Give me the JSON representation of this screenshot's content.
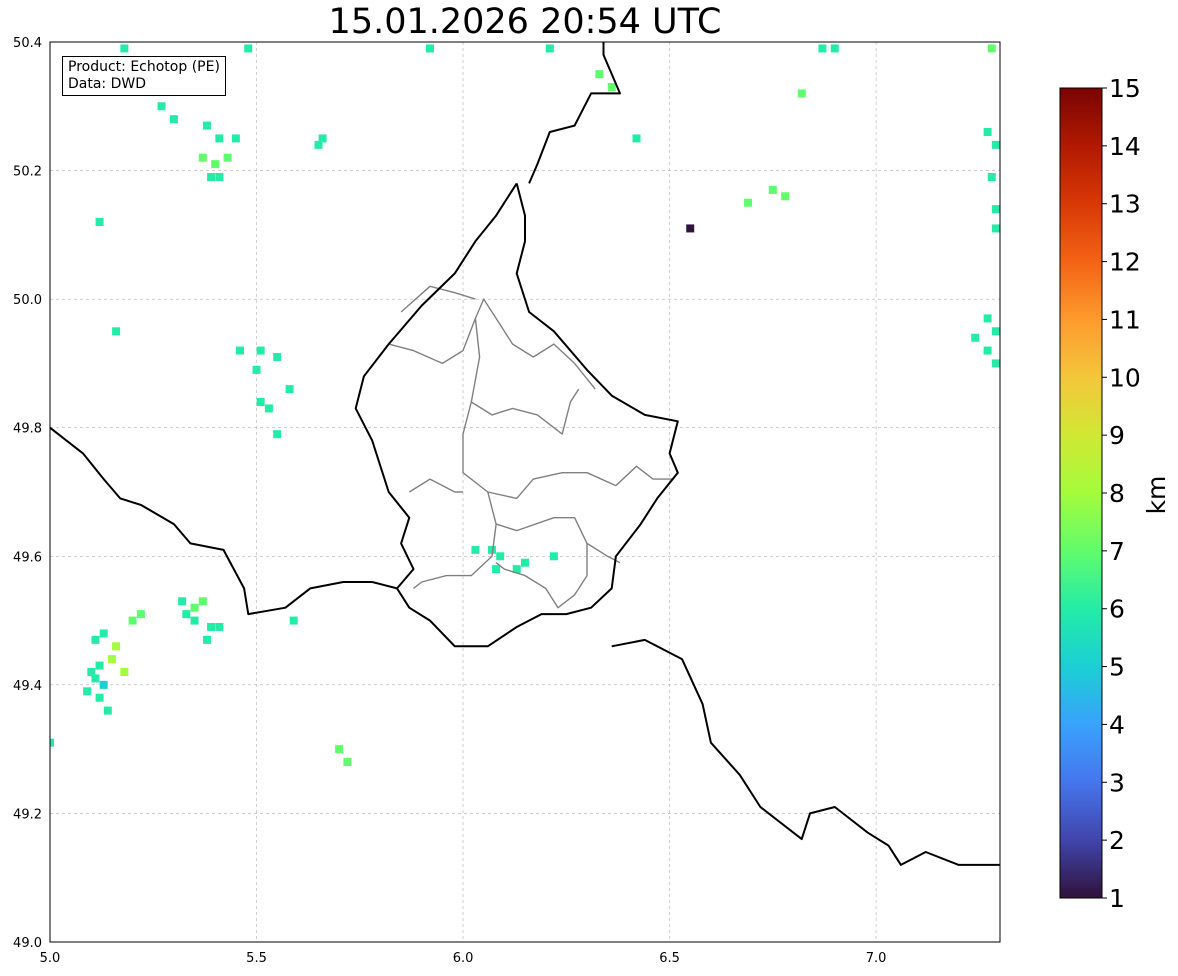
{
  "title": "15.01.2026 20:54 UTC",
  "info": {
    "product_line": "Product: Echotop (PE)",
    "data_line": "Data: DWD"
  },
  "colorbar": {
    "label": "km",
    "min": 1,
    "max": 15,
    "ticks": [
      "1",
      "2",
      "3",
      "4",
      "5",
      "6",
      "7",
      "8",
      "9",
      "10",
      "11",
      "12",
      "13",
      "14",
      "15"
    ],
    "colormap": [
      "#30123b",
      "#4145ab",
      "#4675ed",
      "#39a2fc",
      "#1bcfd4",
      "#24eca6",
      "#61fc6c",
      "#a4fc3b",
      "#d1e834",
      "#f3c63a",
      "#fe9b2d",
      "#f36315",
      "#d93806",
      "#b11901",
      "#7a0402"
    ]
  },
  "map": {
    "lon_range": [
      5.0,
      7.3
    ],
    "lat_range": [
      49.0,
      50.4
    ],
    "x_ticks": [
      "5.0",
      "5.5",
      "6.0",
      "6.5",
      "7.0"
    ],
    "y_ticks": [
      "49.0",
      "49.2",
      "49.4",
      "49.6",
      "49.8",
      "50.0",
      "50.2",
      "50.4"
    ],
    "grid": "dashed",
    "border_color": "#000000",
    "canton_color": "#808080",
    "national_borders": [
      [
        [
          6.13,
          50.18
        ],
        [
          6.08,
          50.13
        ],
        [
          6.03,
          50.09
        ],
        [
          5.98,
          50.04
        ],
        [
          5.9,
          49.99
        ],
        [
          5.82,
          49.93
        ],
        [
          5.76,
          49.88
        ],
        [
          5.74,
          49.83
        ],
        [
          5.78,
          49.78
        ],
        [
          5.82,
          49.7
        ],
        [
          5.87,
          49.66
        ],
        [
          5.85,
          49.62
        ],
        [
          5.88,
          49.58
        ],
        [
          5.84,
          49.55
        ],
        [
          5.78,
          49.56
        ]
      ],
      [
        [
          6.13,
          50.18
        ],
        [
          6.15,
          50.13
        ],
        [
          6.15,
          50.09
        ],
        [
          6.13,
          50.04
        ],
        [
          6.16,
          49.98
        ],
        [
          6.22,
          49.95
        ],
        [
          6.3,
          49.89
        ],
        [
          6.36,
          49.85
        ],
        [
          6.44,
          49.82
        ],
        [
          6.52,
          49.81
        ],
        [
          6.5,
          49.76
        ],
        [
          6.52,
          49.73
        ],
        [
          6.47,
          49.69
        ],
        [
          6.43,
          49.65
        ],
        [
          6.37,
          49.6
        ],
        [
          6.36,
          49.55
        ],
        [
          6.31,
          49.52
        ],
        [
          6.25,
          49.51
        ],
        [
          6.19,
          49.51
        ],
        [
          6.13,
          49.49
        ],
        [
          6.06,
          49.46
        ],
        [
          5.98,
          49.46
        ],
        [
          5.92,
          49.5
        ],
        [
          5.87,
          49.52
        ],
        [
          5.84,
          49.55
        ]
      ],
      [
        [
          6.16,
          50.18
        ],
        [
          6.18,
          50.21
        ],
        [
          6.21,
          50.26
        ],
        [
          6.27,
          50.27
        ],
        [
          6.31,
          50.32
        ],
        [
          6.38,
          50.32
        ],
        [
          6.34,
          50.38
        ],
        [
          6.34,
          50.4
        ]
      ],
      [
        [
          5.0,
          49.8
        ],
        [
          5.08,
          49.76
        ],
        [
          5.13,
          49.72
        ],
        [
          5.17,
          49.69
        ],
        [
          5.22,
          49.68
        ],
        [
          5.3,
          49.65
        ],
        [
          5.34,
          49.62
        ],
        [
          5.42,
          49.61
        ],
        [
          5.47,
          49.55
        ],
        [
          5.48,
          49.51
        ],
        [
          5.57,
          49.52
        ],
        [
          5.63,
          49.55
        ],
        [
          5.71,
          49.56
        ],
        [
          5.78,
          49.56
        ]
      ],
      [
        [
          6.36,
          49.46
        ],
        [
          6.44,
          49.47
        ],
        [
          6.53,
          49.44
        ],
        [
          6.58,
          49.37
        ],
        [
          6.6,
          49.31
        ],
        [
          6.67,
          49.26
        ],
        [
          6.72,
          49.21
        ],
        [
          6.82,
          49.16
        ],
        [
          6.84,
          49.2
        ],
        [
          6.9,
          49.21
        ],
        [
          6.98,
          49.17
        ],
        [
          7.03,
          49.15
        ],
        [
          7.06,
          49.12
        ],
        [
          7.12,
          49.14
        ],
        [
          7.2,
          49.12
        ],
        [
          7.3,
          49.12
        ]
      ]
    ],
    "canton_borders": [
      [
        [
          5.82,
          49.93
        ],
        [
          5.88,
          49.92
        ],
        [
          5.95,
          49.9
        ],
        [
          6.0,
          49.92
        ],
        [
          6.03,
          49.97
        ],
        [
          6.05,
          50.0
        ],
        [
          6.08,
          49.97
        ],
        [
          6.12,
          49.93
        ],
        [
          6.17,
          49.91
        ],
        [
          6.22,
          49.93
        ],
        [
          6.27,
          49.9
        ],
        [
          6.32,
          49.86
        ]
      ],
      [
        [
          5.85,
          49.98
        ],
        [
          5.92,
          50.02
        ],
        [
          5.98,
          50.01
        ],
        [
          6.03,
          50.0
        ]
      ],
      [
        [
          6.03,
          49.97
        ],
        [
          6.04,
          49.91
        ],
        [
          6.02,
          49.84
        ],
        [
          6.07,
          49.82
        ],
        [
          6.12,
          49.83
        ],
        [
          6.18,
          49.82
        ],
        [
          6.24,
          49.79
        ],
        [
          6.26,
          49.84
        ],
        [
          6.28,
          49.86
        ]
      ],
      [
        [
          6.02,
          49.84
        ],
        [
          6.0,
          49.79
        ],
        [
          6.0,
          49.73
        ],
        [
          6.06,
          49.7
        ],
        [
          6.13,
          49.69
        ],
        [
          6.17,
          49.72
        ],
        [
          6.24,
          49.73
        ],
        [
          6.3,
          49.73
        ],
        [
          6.37,
          49.71
        ],
        [
          6.42,
          49.74
        ],
        [
          6.46,
          49.72
        ],
        [
          6.51,
          49.72
        ]
      ],
      [
        [
          5.87,
          49.7
        ],
        [
          5.92,
          49.72
        ],
        [
          5.98,
          49.7
        ],
        [
          6.0,
          49.7
        ]
      ],
      [
        [
          6.06,
          49.7
        ],
        [
          6.08,
          49.65
        ],
        [
          6.07,
          49.6
        ],
        [
          6.02,
          49.57
        ],
        [
          5.96,
          49.57
        ],
        [
          5.9,
          49.56
        ],
        [
          5.88,
          49.55
        ]
      ],
      [
        [
          6.08,
          49.65
        ],
        [
          6.13,
          49.64
        ],
        [
          6.22,
          49.66
        ],
        [
          6.27,
          49.66
        ],
        [
          6.3,
          49.62
        ],
        [
          6.35,
          49.6
        ],
        [
          6.38,
          49.59
        ]
      ],
      [
        [
          6.3,
          49.62
        ],
        [
          6.3,
          49.57
        ],
        [
          6.27,
          49.54
        ],
        [
          6.23,
          49.52
        ],
        [
          6.2,
          49.55
        ],
        [
          6.15,
          49.57
        ],
        [
          6.1,
          49.58
        ],
        [
          6.08,
          49.59
        ]
      ]
    ],
    "echo_pixels": [
      [
        5.18,
        50.39,
        6
      ],
      [
        5.48,
        50.39,
        6
      ],
      [
        5.92,
        50.39,
        6
      ],
      [
        6.21,
        50.39,
        6
      ],
      [
        6.87,
        50.39,
        6
      ],
      [
        6.9,
        50.39,
        6
      ],
      [
        7.28,
        50.39,
        7
      ],
      [
        6.33,
        50.35,
        7
      ],
      [
        6.36,
        50.33,
        7
      ],
      [
        5.34,
        50.33,
        6
      ],
      [
        5.27,
        50.3,
        6
      ],
      [
        5.3,
        50.28,
        6
      ],
      [
        5.38,
        50.27,
        6
      ],
      [
        5.41,
        50.25,
        6
      ],
      [
        5.45,
        50.25,
        6
      ],
      [
        6.42,
        50.25,
        6
      ],
      [
        5.37,
        50.22,
        7
      ],
      [
        5.4,
        50.21,
        7
      ],
      [
        5.43,
        50.22,
        7
      ],
      [
        5.39,
        50.19,
        6
      ],
      [
        5.41,
        50.19,
        6
      ],
      [
        5.65,
        50.24,
        6
      ],
      [
        5.66,
        50.25,
        6
      ],
      [
        6.82,
        50.32,
        7
      ],
      [
        6.75,
        50.17,
        7
      ],
      [
        6.78,
        50.16,
        7
      ],
      [
        6.69,
        50.15,
        7
      ],
      [
        7.27,
        50.26,
        6
      ],
      [
        7.29,
        50.24,
        6
      ],
      [
        7.28,
        50.19,
        6
      ],
      [
        7.29,
        50.14,
        6
      ],
      [
        7.29,
        50.11,
        6
      ],
      [
        5.12,
        50.12,
        6
      ],
      [
        5.16,
        49.95,
        6
      ],
      [
        5.51,
        49.92,
        6
      ],
      [
        5.46,
        49.92,
        6
      ],
      [
        5.55,
        49.91,
        6
      ],
      [
        5.5,
        49.89,
        6
      ],
      [
        5.58,
        49.86,
        6
      ],
      [
        5.51,
        49.84,
        6
      ],
      [
        5.53,
        49.83,
        6
      ],
      [
        5.55,
        49.79,
        6
      ],
      [
        7.27,
        49.97,
        6
      ],
      [
        7.29,
        49.95,
        6
      ],
      [
        7.27,
        49.92,
        6
      ],
      [
        7.29,
        49.9,
        6
      ],
      [
        7.24,
        49.94,
        6
      ],
      [
        6.55,
        50.11,
        1
      ],
      [
        6.07,
        49.61,
        6
      ],
      [
        6.09,
        49.6,
        6
      ],
      [
        6.08,
        49.58,
        6
      ],
      [
        6.15,
        49.59,
        6
      ],
      [
        6.22,
        49.6,
        6
      ],
      [
        6.03,
        49.61,
        6
      ],
      [
        6.13,
        49.58,
        6
      ],
      [
        5.35,
        49.52,
        7
      ],
      [
        5.37,
        49.53,
        7
      ],
      [
        5.35,
        49.5,
        6
      ],
      [
        5.39,
        49.49,
        6
      ],
      [
        5.32,
        49.53,
        6
      ],
      [
        5.38,
        49.47,
        6
      ],
      [
        5.41,
        49.49,
        6
      ],
      [
        5.33,
        49.51,
        6
      ],
      [
        5.22,
        49.51,
        7
      ],
      [
        5.2,
        49.5,
        7
      ],
      [
        5.11,
        49.47,
        6
      ],
      [
        5.13,
        49.48,
        6
      ],
      [
        5.16,
        49.46,
        8
      ],
      [
        5.15,
        49.44,
        8
      ],
      [
        5.18,
        49.42,
        8
      ],
      [
        5.12,
        49.43,
        6
      ],
      [
        5.11,
        49.41,
        6
      ],
      [
        5.13,
        49.4,
        5
      ],
      [
        5.09,
        49.39,
        6
      ],
      [
        5.12,
        49.38,
        6
      ],
      [
        5.14,
        49.36,
        6
      ],
      [
        5.1,
        49.42,
        6
      ],
      [
        5.59,
        49.5,
        6
      ],
      [
        5.7,
        49.3,
        7
      ],
      [
        5.72,
        49.28,
        7
      ],
      [
        5.0,
        49.31,
        6
      ]
    ]
  }
}
